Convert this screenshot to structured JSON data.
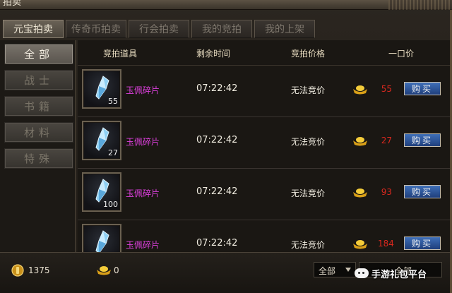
{
  "window": {
    "title": "拍卖"
  },
  "tabs": [
    {
      "label": "元宝拍卖",
      "active": true
    },
    {
      "label": "传奇币拍卖",
      "active": false
    },
    {
      "label": "行会拍卖",
      "active": false
    },
    {
      "label": "我的竞拍",
      "active": false
    },
    {
      "label": "我的上架",
      "active": false
    }
  ],
  "categories": [
    {
      "label": "全部",
      "active": true
    },
    {
      "label": "战士",
      "active": false
    },
    {
      "label": "书籍",
      "active": false
    },
    {
      "label": "材料",
      "active": false
    },
    {
      "label": "特殊",
      "active": false
    }
  ],
  "table": {
    "headers": {
      "item": "竞拍道具",
      "time": "剩余时间",
      "bid": "竞拍价格",
      "buyout": "一口价"
    },
    "rows": [
      {
        "icon": "jade-shard-icon",
        "qty": "55",
        "name": "玉佩碎片",
        "time": "07:22:42",
        "bid": "无法竞价",
        "price": "55",
        "buy": "购买"
      },
      {
        "icon": "jade-shard-icon",
        "qty": "27",
        "name": "玉佩碎片",
        "time": "07:22:42",
        "bid": "无法竞价",
        "price": "27",
        "buy": "购买"
      },
      {
        "icon": "jade-shard-icon",
        "qty": "100",
        "name": "玉佩碎片",
        "time": "07:22:42",
        "bid": "无法竞价",
        "price": "93",
        "buy": "购买"
      },
      {
        "icon": "jade-shard-icon",
        "qty": "",
        "name": "玉佩碎片",
        "time": "07:22:42",
        "bid": "无法竞价",
        "price": "184",
        "buy": "购买"
      }
    ]
  },
  "footer": {
    "gold_coins": "1375",
    "ingots": "0",
    "filter_selected": "全部",
    "filter2_selected": "全部"
  },
  "watermark": {
    "text": "手游礼包平台"
  },
  "colors": {
    "item_name": "#e040e0",
    "price": "#d8281e",
    "buy_button": "#2a4f94"
  }
}
